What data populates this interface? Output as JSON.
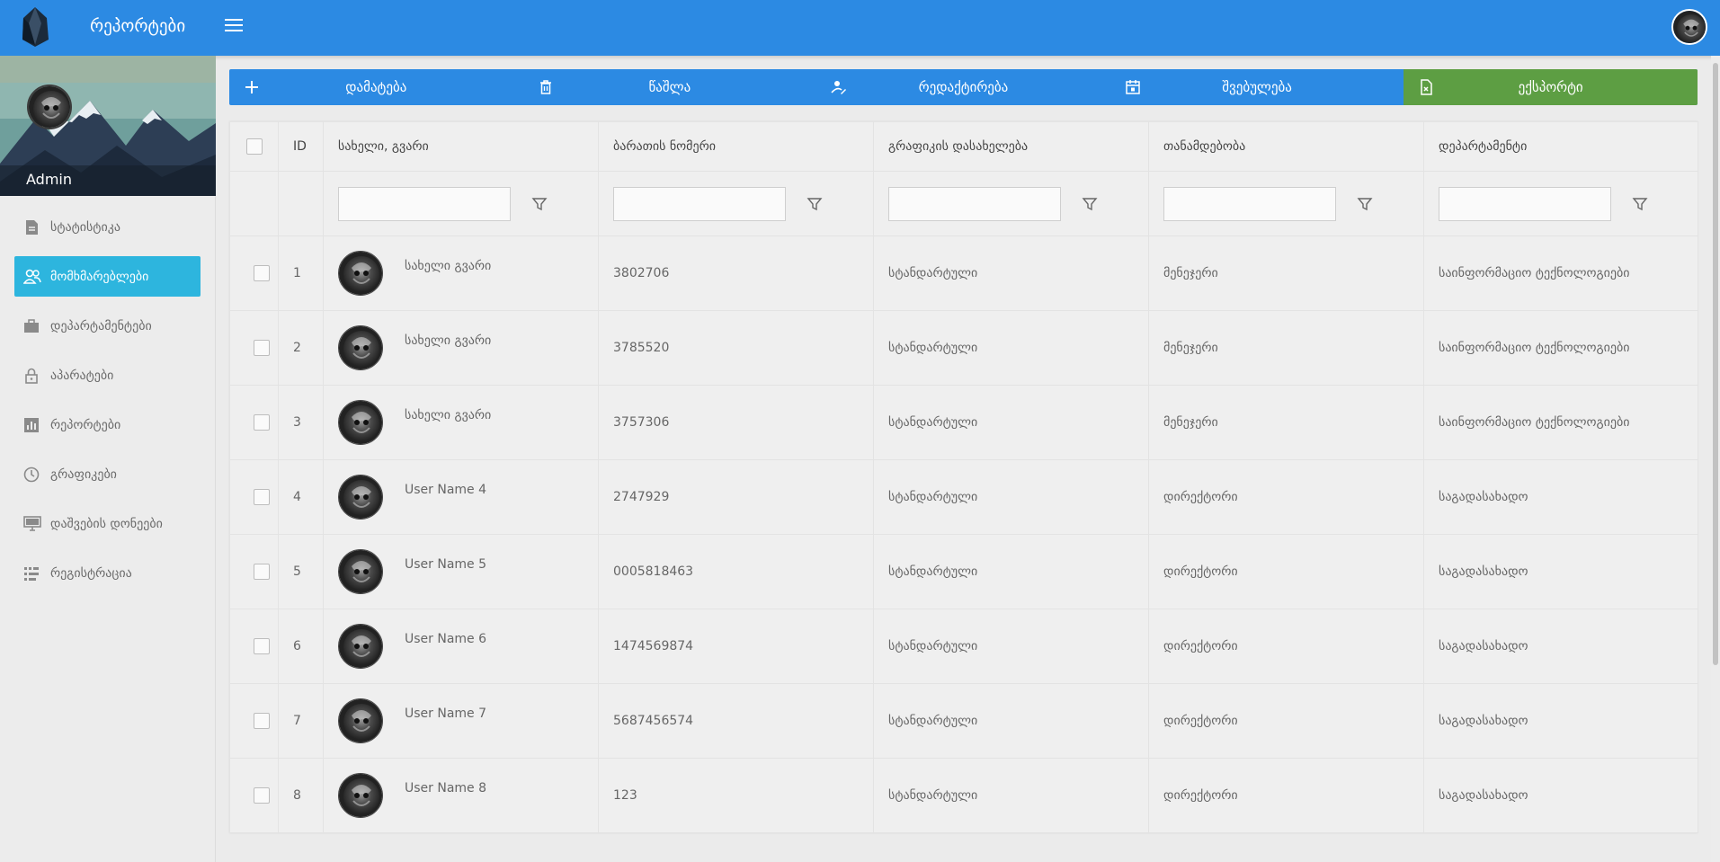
{
  "app": {
    "title": "რეპორტები"
  },
  "sidebar": {
    "profile_name": "Admin",
    "items": [
      {
        "label": "სტატისტიკა",
        "icon": "file-icon",
        "active": false
      },
      {
        "label": "მომხმარებლები",
        "icon": "users-icon",
        "active": true
      },
      {
        "label": "დეპარტამენტები",
        "icon": "briefcase-icon",
        "active": false
      },
      {
        "label": "აპარატები",
        "icon": "lock-icon",
        "active": false
      },
      {
        "label": "რეპორტები",
        "icon": "bar-chart-icon",
        "active": false
      },
      {
        "label": "გრაფიკები",
        "icon": "clock-icon",
        "active": false
      },
      {
        "label": "დაშვების დონეები",
        "icon": "monitor-icon",
        "active": false
      },
      {
        "label": "რეგისტრაცია",
        "icon": "list-icon",
        "active": false
      }
    ]
  },
  "toolbar": {
    "add_label": "დამატება",
    "delete_label": "წაშლა",
    "edit_label": "რედაქტირება",
    "vacation_label": "შვებულება",
    "export_label": "ექსპორტი"
  },
  "colors": {
    "primary": "#2c8ae3",
    "active_nav": "#2db5de",
    "export": "#5d9e43"
  },
  "table": {
    "headers": {
      "id": "ID",
      "name": "სახელი, გვარი",
      "card": "ბარათის ნომერი",
      "schedule": "გრაფიკის დასახელება",
      "position": "თანამდებობა",
      "department": "დეპარტამენტი"
    },
    "rows": [
      {
        "id": "1",
        "name": "სახელი გვარი",
        "card": "3802706",
        "schedule": "სტანდარტული",
        "position": "მენეჯერი",
        "department": "საინფორმაციო ტექნოლოგიები"
      },
      {
        "id": "2",
        "name": "სახელი გვარი",
        "card": "3785520",
        "schedule": "სტანდარტული",
        "position": "მენეჯერი",
        "department": "საინფორმაციო ტექნოლოგიები"
      },
      {
        "id": "3",
        "name": "სახელი გვარი",
        "card": "3757306",
        "schedule": "სტანდარტული",
        "position": "მენეჯერი",
        "department": "საინფორმაციო ტექნოლოგიები"
      },
      {
        "id": "4",
        "name": "User Name 4",
        "card": "2747929",
        "schedule": "სტანდარტული",
        "position": "დირექტორი",
        "department": "საგადასახადო"
      },
      {
        "id": "5",
        "name": "User Name 5",
        "card": "0005818463",
        "schedule": "სტანდარტული",
        "position": "დირექტორი",
        "department": "საგადასახადო"
      },
      {
        "id": "6",
        "name": "User Name 6",
        "card": "1474569874",
        "schedule": "სტანდარტული",
        "position": "დირექტორი",
        "department": "საგადასახადო"
      },
      {
        "id": "7",
        "name": "User Name 7",
        "card": "5687456574",
        "schedule": "სტანდარტული",
        "position": "დირექტორი",
        "department": "საგადასახადო"
      },
      {
        "id": "8",
        "name": "User Name 8",
        "card": "123",
        "schedule": "სტანდარტული",
        "position": "დირექტორი",
        "department": "საგადასახადო"
      }
    ]
  }
}
